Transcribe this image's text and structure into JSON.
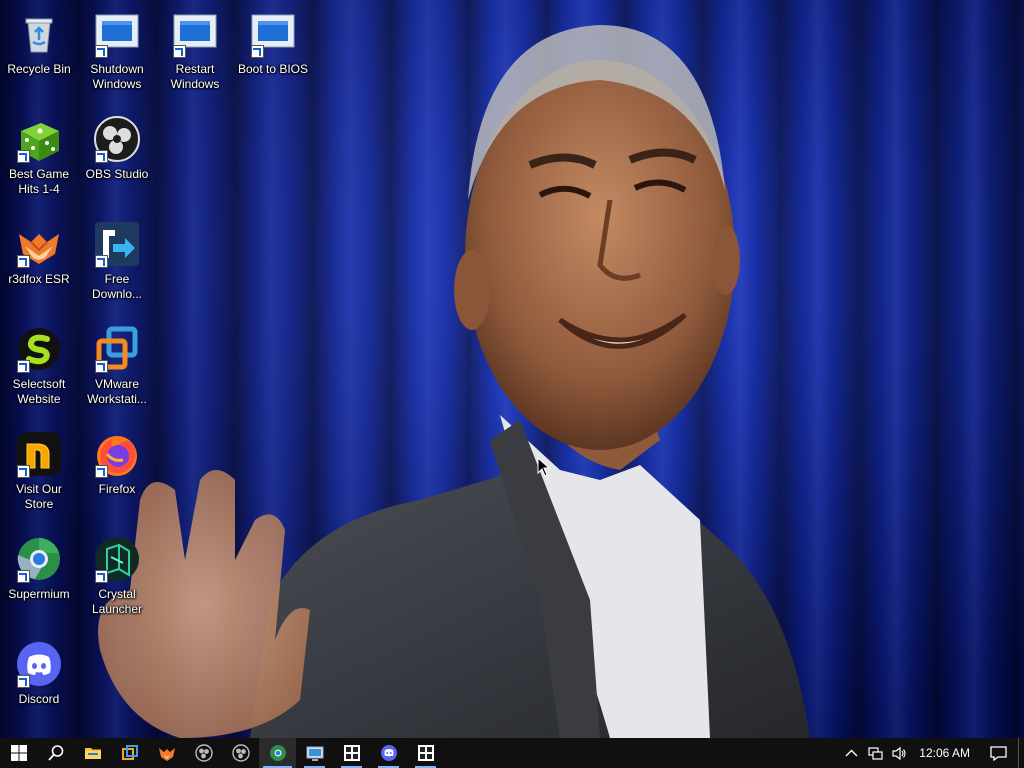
{
  "desktop": {
    "icons": [
      {
        "label": "Recycle Bin"
      },
      {
        "label": "Shutdown\nWindows"
      },
      {
        "label": "Restart\nWindows"
      },
      {
        "label": "Boot to BIOS"
      },
      {
        "label": "Best Game\nHits 1-4"
      },
      {
        "label": "OBS Studio"
      },
      {
        "label": "r3dfox ESR"
      },
      {
        "label": "Free\nDownlo..."
      },
      {
        "label": "Selectsoft\nWebsite"
      },
      {
        "label": "VMware\nWorkstati..."
      },
      {
        "label": "Visit Our\nStore"
      },
      {
        "label": "Firefox"
      },
      {
        "label": "Supermium"
      },
      {
        "label": "Crystal\nLauncher"
      },
      {
        "label": "Discord"
      }
    ]
  },
  "taskbar": {
    "clock": "12:06 AM",
    "pinned": [
      "start-icon",
      "search-icon",
      "file-explorer-icon",
      "task-manager-icon",
      "r3dfox-icon",
      "obs-icon",
      "obs-icon-2",
      "supermium-icon",
      "display-settings-icon",
      "app-window-icon",
      "discord-icon",
      "app-window-icon-2"
    ]
  },
  "colors": {
    "taskbar_bg": "#101010",
    "accent": "#7fb2ff",
    "wallpaper_blue": "#1330b8"
  }
}
